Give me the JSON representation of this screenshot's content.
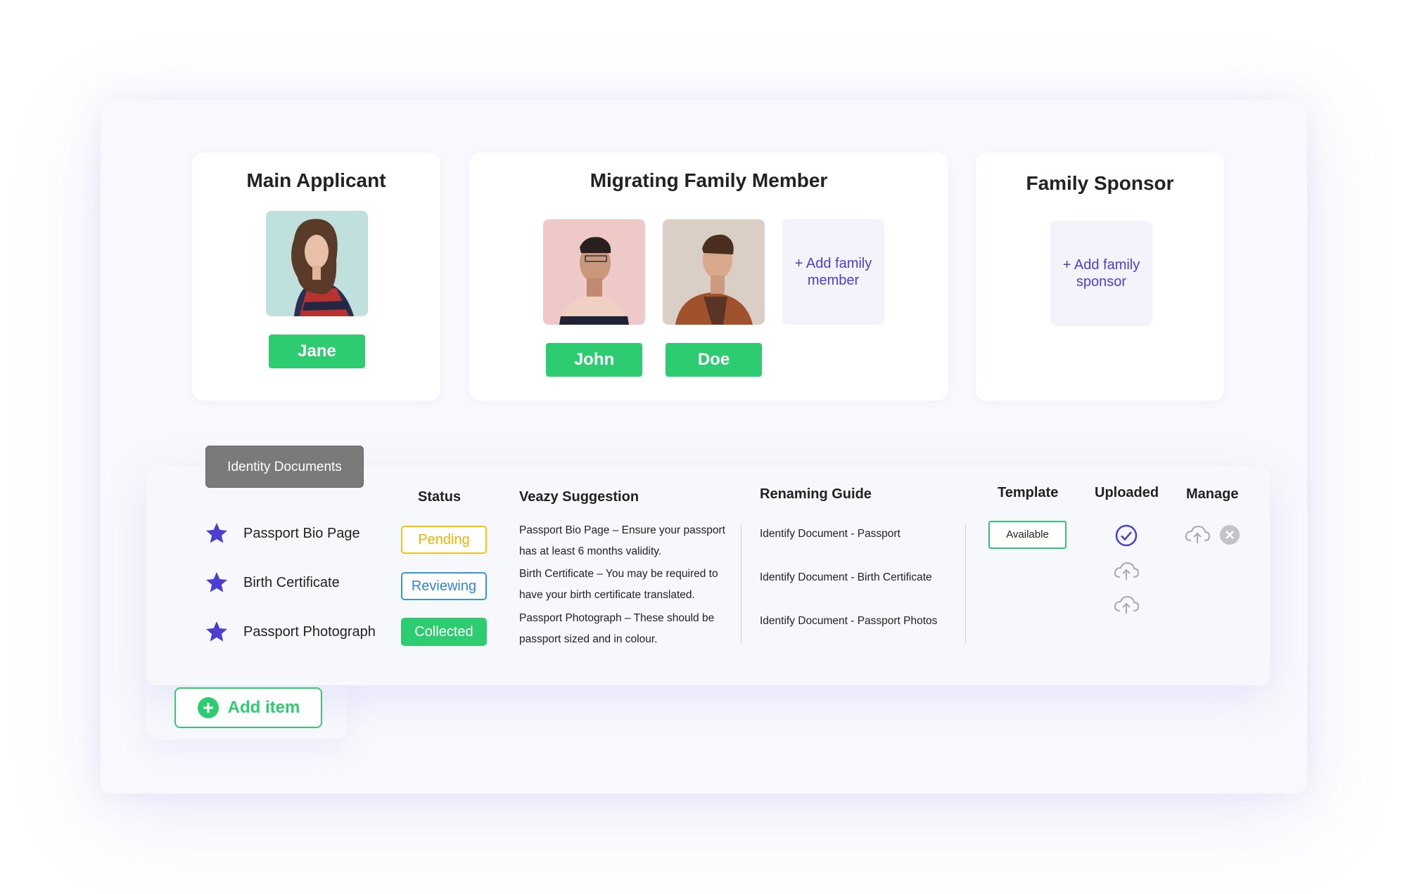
{
  "cards": {
    "main_applicant": {
      "title": "Main Applicant",
      "members": [
        {
          "name": "Jane"
        }
      ]
    },
    "migrating_family": {
      "title": "Migrating Family Member",
      "members": [
        {
          "name": "John"
        },
        {
          "name": "Doe"
        }
      ],
      "add_label": "+ Add family member"
    },
    "family_sponsor": {
      "title": "Family Sponsor",
      "add_label": "+ Add family sponsor"
    }
  },
  "documents": {
    "tab_label": "Identity Documents",
    "headers": {
      "status": "Status",
      "suggestion": "Veazy Suggestion",
      "renaming": "Renaming Guide",
      "template": "Template",
      "uploaded": "Uploaded",
      "manage": "Manage"
    },
    "rows": [
      {
        "name": "Passport Bio Page",
        "status": "Pending",
        "suggestion": "Passport Bio Page – Ensure your passport has at least 6 months validity.",
        "renaming": "Identify Document - Passport"
      },
      {
        "name": "Birth Certificate",
        "status": "Reviewing",
        "suggestion": "Birth Certificate – You may be required to have your birth certificate translated.",
        "renaming": "Identify Document - Birth Certificate"
      },
      {
        "name": "Passport Photograph",
        "status": "Collected",
        "suggestion": "Passport Photograph – These should be passport sized and in colour.",
        "renaming": "Identify Document - Passport Photos"
      }
    ],
    "template_label": "Available",
    "add_item_label": "Add item"
  },
  "colors": {
    "accent_green": "#2ecc71",
    "accent_purple": "#4b3fd1",
    "pending": "#f1c40f",
    "reviewing": "#3498db"
  },
  "icons": {
    "star": "star-icon",
    "uploaded_check": "check-circle-icon",
    "upload": "cloud-upload-icon",
    "remove": "close-circle-icon",
    "add": "plus-circle-icon"
  }
}
